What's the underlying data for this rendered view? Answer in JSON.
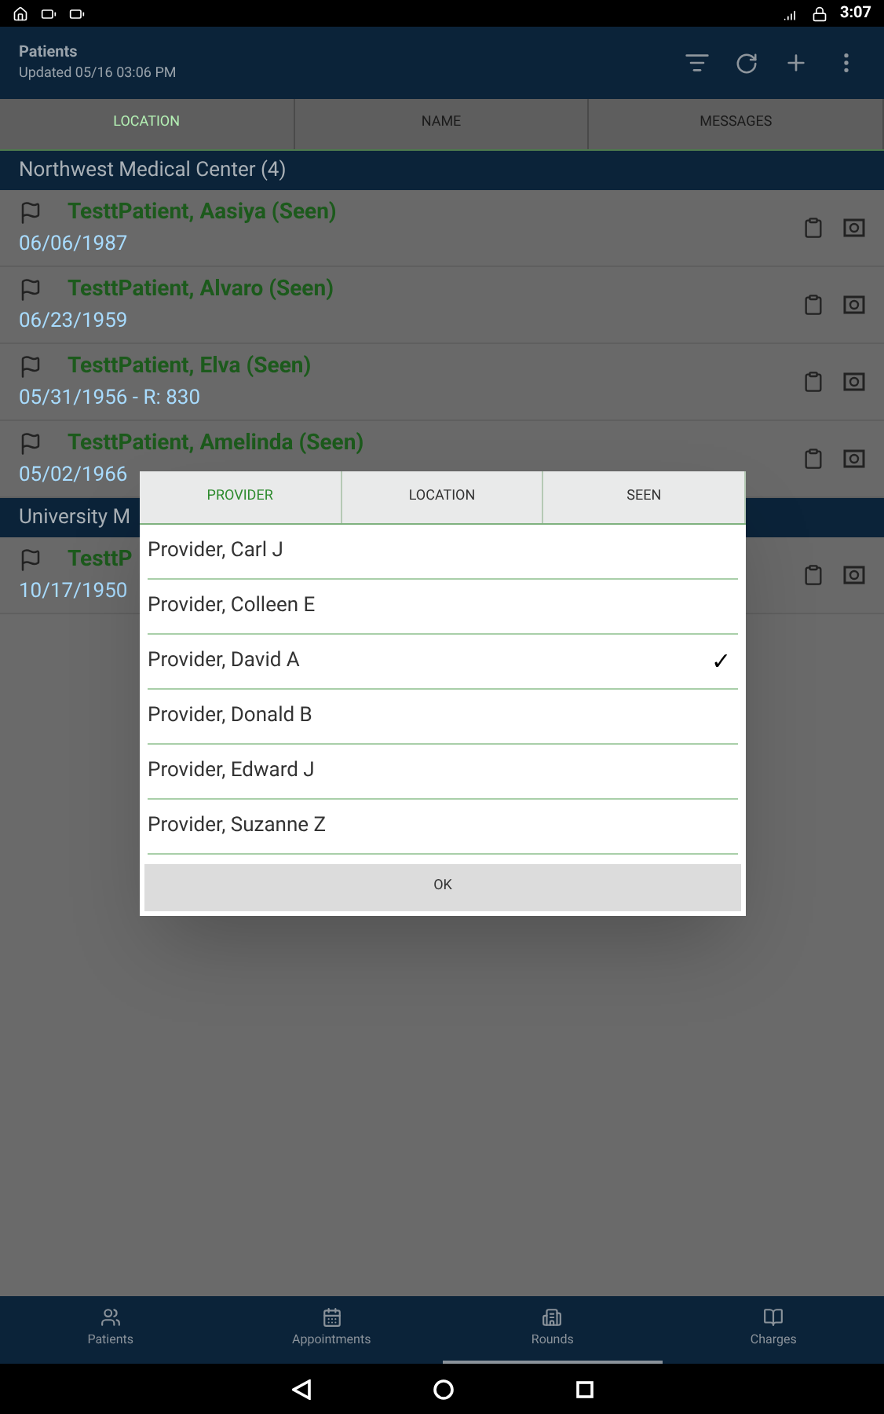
{
  "status_bar": {
    "time": "3:07"
  },
  "header": {
    "title": "Patients",
    "subtitle": "Updated 05/16 03:06 PM"
  },
  "tabs": [
    {
      "label": "LOCATION",
      "selected": true
    },
    {
      "label": "NAME",
      "selected": false
    },
    {
      "label": "MESSAGES",
      "selected": false
    }
  ],
  "groups": [
    {
      "title": "Northwest Medical Center (4)",
      "patients": [
        {
          "name": "TesttPatient, Aasiya (Seen)",
          "detail": "06/06/1987"
        },
        {
          "name": "TesttPatient, Alvaro (Seen)",
          "detail": "06/23/1959"
        },
        {
          "name": "TesttPatient, Elva (Seen)",
          "detail": "05/31/1956 - R: 830"
        },
        {
          "name": "TesttPatient, Amelinda (Seen)",
          "detail": "05/02/1966"
        }
      ]
    },
    {
      "title": "University M",
      "patients": [
        {
          "name": "TesttP",
          "detail": "10/17/1950"
        }
      ]
    }
  ],
  "dialog": {
    "tabs": [
      {
        "label": "PROVIDER",
        "selected": true
      },
      {
        "label": "LOCATION",
        "selected": false
      },
      {
        "label": "SEEN",
        "selected": false
      }
    ],
    "items": [
      {
        "label": "Provider, Carl J",
        "checked": false
      },
      {
        "label": "Provider, Colleen E",
        "checked": false
      },
      {
        "label": "Provider, David A",
        "checked": true
      },
      {
        "label": "Provider, Donald B",
        "checked": false
      },
      {
        "label": "Provider, Edward J",
        "checked": false
      },
      {
        "label": "Provider, Suzanne Z",
        "checked": false
      }
    ],
    "check_mark": "✓",
    "ok": "OK"
  },
  "bottom_nav": [
    {
      "label": "Patients",
      "selected": false
    },
    {
      "label": "Appointments",
      "selected": false
    },
    {
      "label": "Rounds",
      "selected": true
    },
    {
      "label": "Charges",
      "selected": false
    }
  ]
}
